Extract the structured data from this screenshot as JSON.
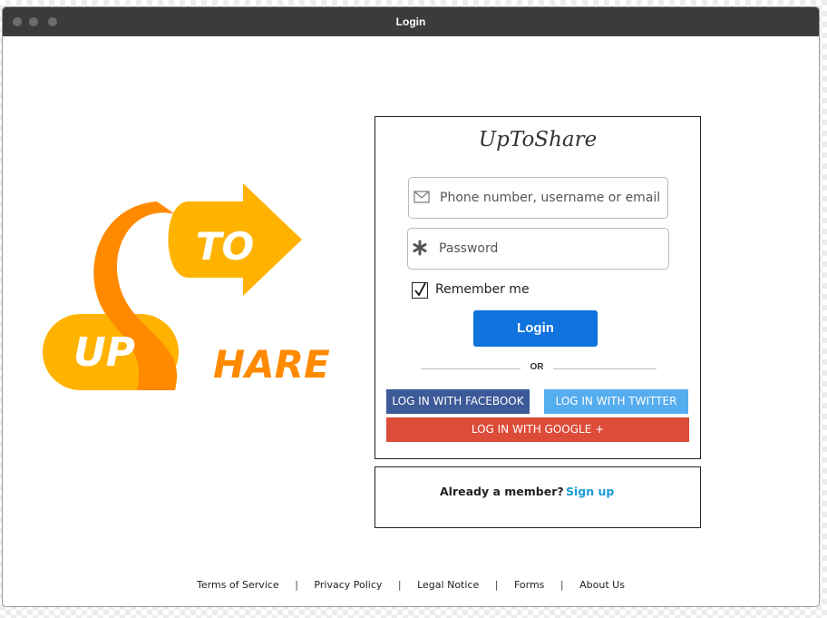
{
  "window": {
    "title": "Login"
  },
  "logo": {
    "word_up": "UP",
    "word_to": "TO",
    "word_hare": "HARE",
    "colors": {
      "orange": "#ff8a00",
      "yellow": "#ffb300"
    }
  },
  "login": {
    "brand": "UpToShare",
    "username_placeholder": "Phone number, username or email",
    "password_placeholder": "Password",
    "remember_label": "Remember me",
    "remember_checked": true,
    "login_button": "Login",
    "or_label": "OR",
    "facebook_button": "LOG IN WITH FACEBOOK",
    "twitter_button": "LOG IN WITH TWITTER",
    "google_button": "LOG IN WITH GOOGLE +"
  },
  "signup": {
    "prompt": "Already a member?",
    "link": "Sign up"
  },
  "footer": {
    "links": [
      "Terms of Service",
      "Privacy Policy",
      "Legal Notice",
      "Forms",
      "About Us"
    ],
    "separator": "|"
  },
  "colors": {
    "login": "#0f72dd",
    "facebook": "#3d5a98",
    "twitter": "#55acee",
    "google": "#dd4b39",
    "link": "#1a9ad6"
  }
}
